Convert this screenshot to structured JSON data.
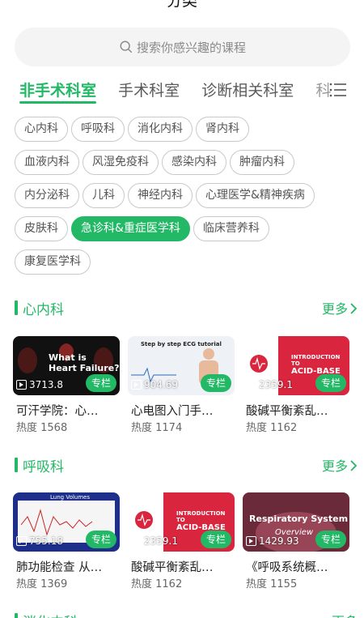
{
  "header": {
    "title": "分类"
  },
  "search": {
    "placeholder": "搜索你感兴趣的课程"
  },
  "tabs": [
    {
      "label": "非手术科室",
      "active": true
    },
    {
      "label": "手术科室",
      "active": false
    },
    {
      "label": "诊断相关科室",
      "active": false
    },
    {
      "label": "科",
      "active": false
    }
  ],
  "chips": [
    [
      "心内科",
      "呼吸科",
      "消化内科",
      "肾内科"
    ],
    [
      "血液内科",
      "风湿免疫科",
      "感染内科",
      "肿瘤内科"
    ],
    [
      "内分泌科",
      "儿科",
      "神经内科",
      "心理医学&精神疾病"
    ],
    [
      "皮肤科",
      "急诊科&重症医学科",
      "临床营养科"
    ],
    [
      "康复医学科"
    ]
  ],
  "active_chip": "急诊科&重症医学科",
  "sections": [
    {
      "title": "心内科",
      "more": "更多",
      "cards": [
        {
          "name": "可汗学院：心…",
          "heat": "热度 1568",
          "count": "3713.8",
          "badge": "专栏",
          "thumb_text": "What is Heart Failure?"
        },
        {
          "name": "心电图入门手…",
          "heat": "热度 1174",
          "count": "904.69",
          "badge": "专栏",
          "thumb_text": "Step by step ECG tutorial"
        },
        {
          "name": "酸碱平衡紊乱…",
          "heat": "热度 1162",
          "count": "2359.1",
          "badge": "专栏",
          "thumb_text": "INTRODUCTION TO ACID-BASE"
        }
      ]
    },
    {
      "title": "呼吸科",
      "more": "更多",
      "cards": [
        {
          "name": "肺功能检查 从…",
          "heat": "热度 1369",
          "count": "755.18",
          "badge": "专栏",
          "thumb_text": "Lung Volumes"
        },
        {
          "name": "酸碱平衡紊乱…",
          "heat": "热度 1162",
          "count": "2359.1",
          "badge": "专栏",
          "thumb_text": "INTRODUCTION TO ACID-BASE"
        },
        {
          "name": "《呼吸系统概…",
          "heat": "热度 1155",
          "count": "1429.93",
          "badge": "专栏",
          "thumb_text": "Respiratory System Overview"
        }
      ]
    },
    {
      "title": "消化内科",
      "more": "更多",
      "cards": []
    }
  ],
  "colors": {
    "accent": "#23b866",
    "chip_border": "#c9c9c9",
    "search_bg": "#f3f4f3"
  },
  "icons": {
    "search": "search-icon",
    "menu": "menu-icon",
    "chevron": "chevron-right-icon",
    "video": "video-icon"
  }
}
